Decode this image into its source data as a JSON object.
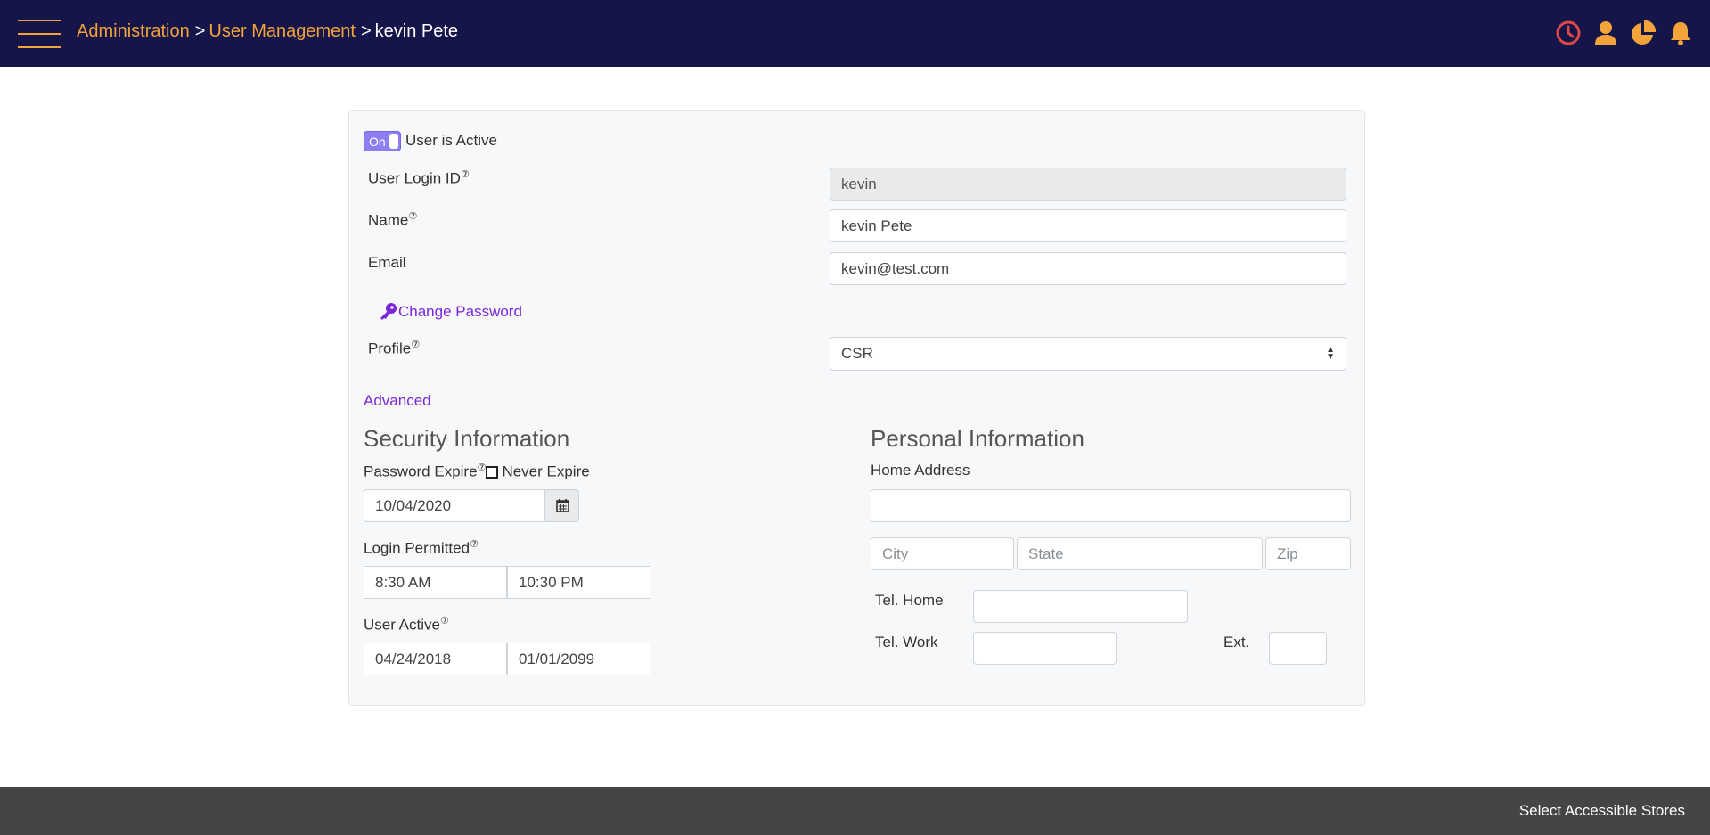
{
  "header": {
    "breadcrumb": {
      "administration": "Administration",
      "separator": ">",
      "user_management": "User Management",
      "current": "kevin Pete"
    },
    "icons": [
      "clock-icon",
      "user-icon",
      "pie-chart-icon",
      "bell-icon"
    ],
    "colors": {
      "background": "#16154a",
      "accent": "#f2a33a",
      "clock": "#e04848"
    }
  },
  "form": {
    "active_toggle": {
      "state_label": "On",
      "label": "User is Active"
    },
    "help_glyph": "⑦",
    "login_id": {
      "label": "User Login ID",
      "value": "kevin"
    },
    "name": {
      "label": "Name",
      "value": "kevin Pete"
    },
    "email": {
      "label": "Email",
      "value": "kevin@test.com"
    },
    "change_password": "Change Password",
    "profile": {
      "label": "Profile",
      "value": "CSR",
      "options": [
        "CSR"
      ]
    },
    "advanced": "Advanced"
  },
  "security": {
    "title": "Security Information",
    "password_expire_label": "Password Expire",
    "never_expire_label": "Never Expire",
    "password_expire_date": "10/04/2020",
    "login_permitted_label": "Login Permitted",
    "login_from": "8:30 AM",
    "login_to": "10:30 PM",
    "user_active_label": "User Active",
    "active_from": "04/24/2018",
    "active_to": "01/01/2099"
  },
  "personal": {
    "title": "Personal Information",
    "home_address_label": "Home Address",
    "home_address": "",
    "city_placeholder": "City",
    "state_placeholder": "State",
    "zip_placeholder": "Zip",
    "tel_home_label": "Tel. Home",
    "tel_work_label": "Tel. Work",
    "ext_label": "Ext."
  },
  "footer": {
    "select_stores": "Select Accessible Stores"
  },
  "colors": {
    "link": "#7a26d9",
    "toggle": "#8b7ff2",
    "footer": "#454545"
  }
}
